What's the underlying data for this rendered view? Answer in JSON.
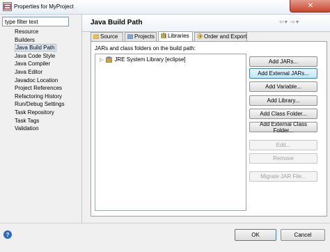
{
  "window": {
    "title": "Properties for MyProject",
    "close_icon": "x-close-icon"
  },
  "filter": {
    "value": "type filter text"
  },
  "nav": {
    "items": [
      {
        "label": "Resource"
      },
      {
        "label": "Builders"
      },
      {
        "label": "Java Build Path",
        "selected": true
      },
      {
        "label": "Java Code Style"
      },
      {
        "label": "Java Compiler"
      },
      {
        "label": "Java Editor"
      },
      {
        "label": "Javadoc Location"
      },
      {
        "label": "Project References"
      },
      {
        "label": "Refactoring History"
      },
      {
        "label": "Run/Debug Settings"
      },
      {
        "label": "Task Repository"
      },
      {
        "label": "Task Tags"
      },
      {
        "label": "Validation"
      }
    ]
  },
  "page": {
    "title": "Java Build Path"
  },
  "tabs": [
    {
      "label": "Source",
      "icon": "source-folder-icon"
    },
    {
      "label": "Projects",
      "icon": "projects-icon"
    },
    {
      "label": "Libraries",
      "icon": "libraries-icon",
      "active": true
    },
    {
      "label": "Order and Export",
      "icon": "order-export-icon"
    }
  ],
  "libraries": {
    "label": "JARs and class folders on the build path:",
    "entries": [
      {
        "label": "JRE System Library [eclipse]",
        "icon": "jar-library-icon"
      }
    ]
  },
  "buttons": {
    "add_jars": "Add JARs...",
    "add_external_jars": "Add External JARs...",
    "add_variable": "Add Variable...",
    "add_library": "Add Library...",
    "add_class_folder": "Add Class Folder...",
    "add_external_class_folder": "Add External Class Folder...",
    "edit": "Edit...",
    "remove": "Remove",
    "migrate_jar": "Migrate JAR File..."
  },
  "footer": {
    "ok": "OK",
    "cancel": "Cancel",
    "help": "?"
  },
  "colors": {
    "selection": "#dde8f5",
    "hover_button": "#bee6fd",
    "close_red": "#c8452c"
  }
}
